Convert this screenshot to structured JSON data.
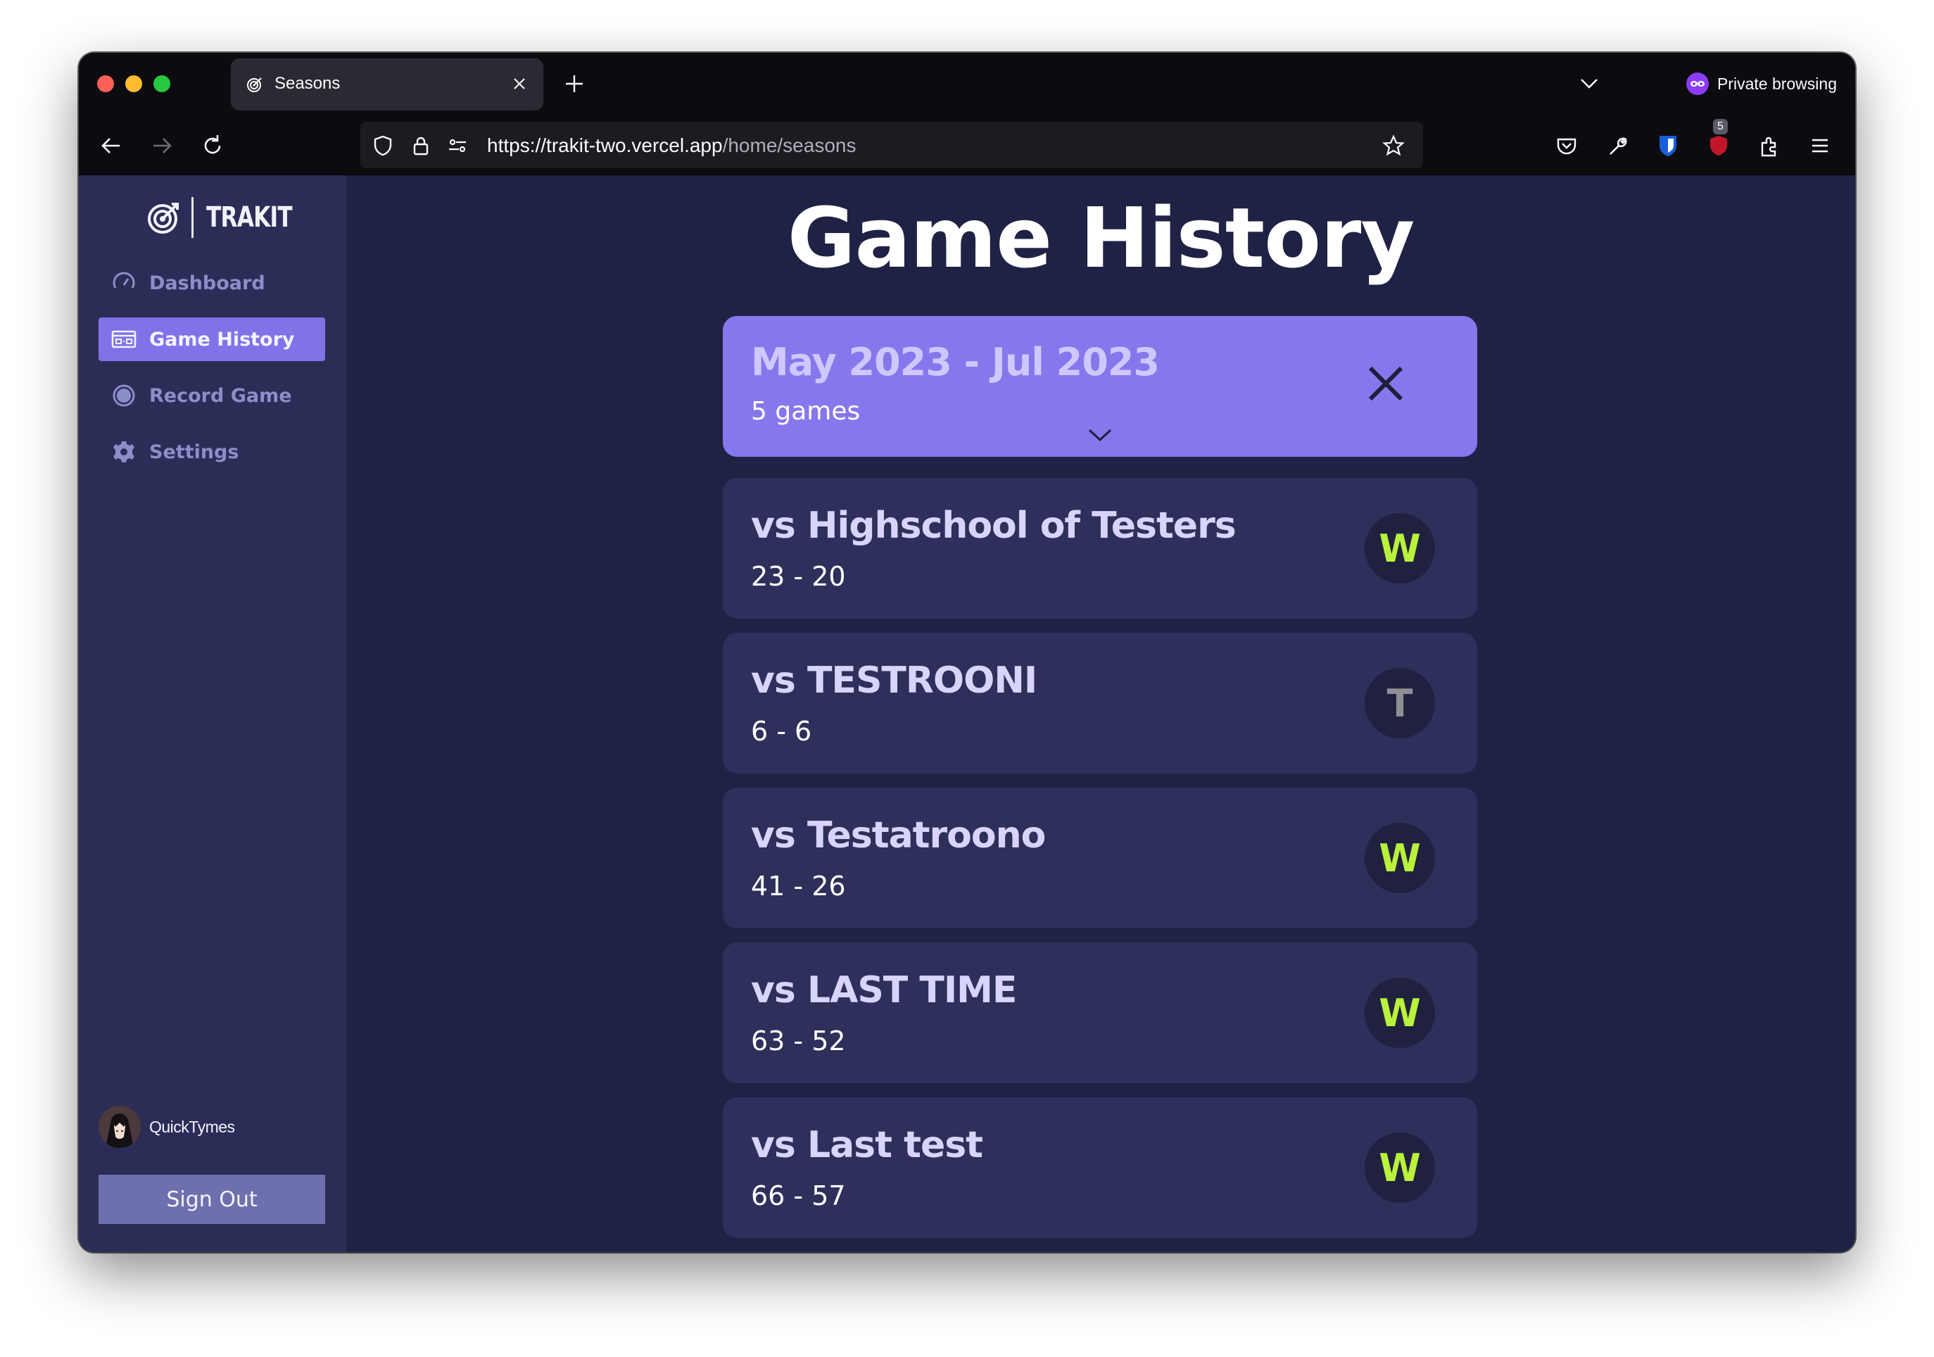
{
  "browser": {
    "tab_title": "Seasons",
    "url_base": "https://trakit-two.vercel.app",
    "url_path": "/home/seasons",
    "private_label": "Private browsing",
    "extension_badge": "5"
  },
  "sidebar": {
    "brand": "TRAKIT",
    "items": [
      {
        "label": "Dashboard",
        "icon": "gauge-icon"
      },
      {
        "label": "Game History",
        "icon": "scoreboard-icon"
      },
      {
        "label": "Record Game",
        "icon": "record-icon"
      },
      {
        "label": "Settings",
        "icon": "gear-icon"
      }
    ],
    "active_item": "Game History",
    "username": "QuickTymes",
    "sign_out": "Sign Out"
  },
  "main": {
    "title": "Game History",
    "season": {
      "name": "May 2023 - Jul 2023",
      "count": "5 games"
    },
    "games": [
      {
        "opponent": "vs Highschool of Testers",
        "score": "23 - 20",
        "result": "W"
      },
      {
        "opponent": "vs TESTROONI",
        "score": "6 - 6",
        "result": "T"
      },
      {
        "opponent": "vs Testatroono",
        "score": "41 - 26",
        "result": "W"
      },
      {
        "opponent": "vs LAST TIME",
        "score": "63 - 52",
        "result": "W"
      },
      {
        "opponent": "vs Last test",
        "score": "66 - 57",
        "result": "W"
      }
    ]
  },
  "colors": {
    "accent": "#8272e8",
    "win": "#b9f23b",
    "tie": "#8e8e95"
  }
}
